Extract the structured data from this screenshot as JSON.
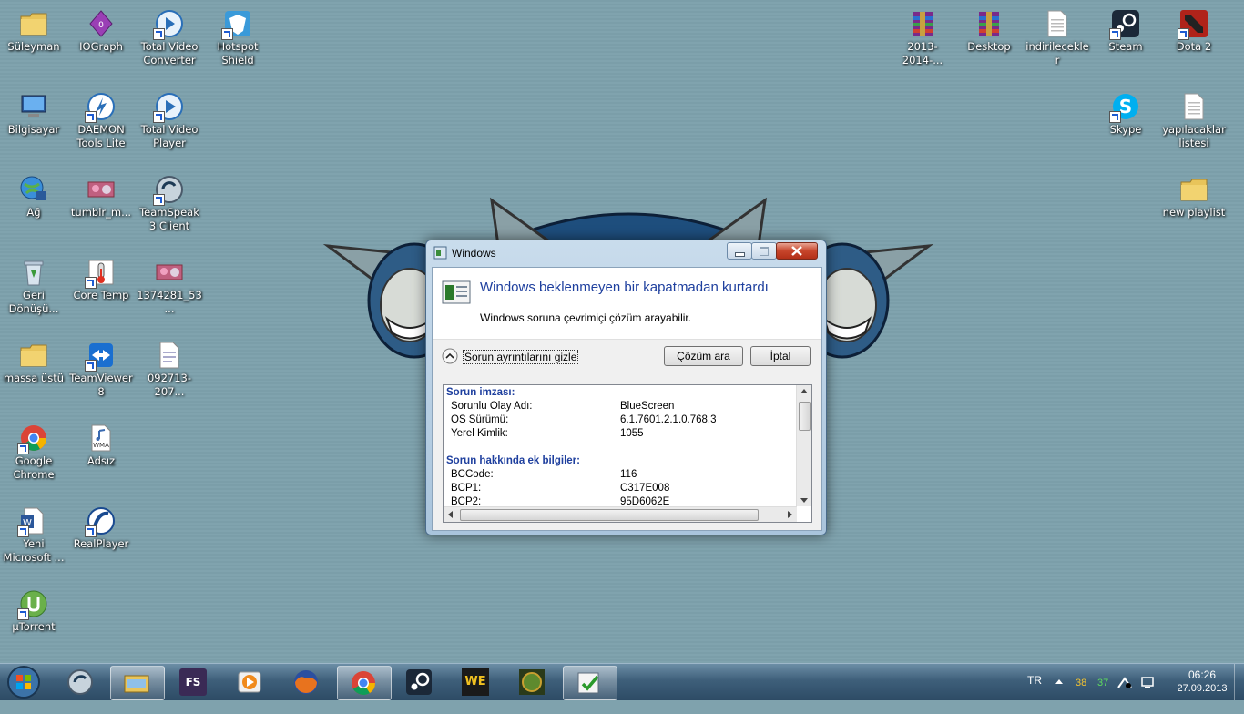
{
  "desktop": {
    "left_icons": [
      {
        "name": "suleyman",
        "label": "Süleyman",
        "icon": "folder-icon"
      },
      {
        "name": "iograph",
        "label": "IOGraph",
        "icon": "iograph-icon"
      },
      {
        "name": "total-video-converter",
        "label": "Total Video Converter",
        "icon": "converter-icon"
      },
      {
        "name": "hotspot-shield",
        "label": "Hotspot Shield",
        "icon": "shield-icon"
      },
      {
        "name": "bilgisayar",
        "label": "Bilgisayar",
        "icon": "computer-icon"
      },
      {
        "name": "daemon-tools",
        "label": "DAEMON Tools Lite",
        "icon": "daemon-icon"
      },
      {
        "name": "total-video-player",
        "label": "Total Video Player",
        "icon": "player-icon"
      },
      {
        "name": "ag",
        "label": "Ağ",
        "icon": "network-icon"
      },
      {
        "name": "tumblr",
        "label": "tumblr_m...",
        "icon": "image-icon"
      },
      {
        "name": "teamspeak",
        "label": "TeamSpeak 3 Client",
        "icon": "teamspeak-icon"
      },
      {
        "name": "recycle-bin",
        "label": "Geri Dönüşü...",
        "icon": "recycle-bin-icon"
      },
      {
        "name": "core-temp",
        "label": "Core Temp",
        "icon": "thermometer-icon"
      },
      {
        "name": "img-1374281",
        "label": "1374281_53...",
        "icon": "image-icon"
      },
      {
        "name": "massa-ustu",
        "label": "massa üstü",
        "icon": "folder-icon"
      },
      {
        "name": "teamviewer",
        "label": "TeamViewer 8",
        "icon": "teamviewer-icon"
      },
      {
        "name": "doc-092713",
        "label": "092713-207...",
        "icon": "file-icon"
      },
      {
        "name": "google-chrome",
        "label": "Google Chrome",
        "icon": "chrome-icon"
      },
      {
        "name": "adsiz",
        "label": "Adsız",
        "icon": "wma-icon"
      },
      {
        "name": "yeni-microsoft",
        "label": "Yeni Microsoft ...",
        "icon": "word-icon"
      },
      {
        "name": "realplayer",
        "label": "RealPlayer",
        "icon": "realplayer-icon"
      },
      {
        "name": "utorrent",
        "label": "µTorrent",
        "icon": "utorrent-icon"
      }
    ],
    "right_icons": [
      {
        "name": "archive-2013",
        "label": "2013-2014-...",
        "icon": "rar-icon"
      },
      {
        "name": "desktop-rar",
        "label": "Desktop",
        "icon": "rar-icon"
      },
      {
        "name": "indirilecekler",
        "label": "indirilecekler",
        "icon": "text-file-icon"
      },
      {
        "name": "steam",
        "label": "Steam",
        "icon": "steam-icon"
      },
      {
        "name": "dota2",
        "label": "Dota 2",
        "icon": "dota-icon"
      },
      {
        "name": "skype",
        "label": "Skype",
        "icon": "skype-icon"
      },
      {
        "name": "yapilacaklar",
        "label": "yapılacaklar listesi",
        "icon": "text-file-icon"
      },
      {
        "name": "new-playlist",
        "label": "new playlist",
        "icon": "folder-icon"
      }
    ]
  },
  "dialog": {
    "title": "Windows",
    "heading": "Windows beklenmeyen bir kapatmadan kurtardı",
    "subtext": "Windows soruna çevrimiçi çözüm arayabilir.",
    "toggle_label": "Sorun ayrıntılarını gizle",
    "solve_button": "Çözüm ara",
    "cancel_button": "İptal",
    "details": {
      "sig_title": "Sorun imzası:",
      "sig_rows": [
        {
          "k": "Sorunlu Olay Adı:",
          "v": "BlueScreen"
        },
        {
          "k": "OS Sürümü:",
          "v": "6.1.7601.2.1.0.768.3"
        },
        {
          "k": "Yerel Kimlik:",
          "v": "1055"
        }
      ],
      "extra_title": "Sorun hakkında ek bilgiler:",
      "extra_rows": [
        {
          "k": "BCCode:",
          "v": "116"
        },
        {
          "k": "BCP1:",
          "v": "C317E008"
        },
        {
          "k": "BCP2:",
          "v": "95D6062E"
        }
      ]
    }
  },
  "taskbar": {
    "items": [
      "start-orb-icon",
      "teamspeak-icon",
      "explorer-icon",
      "fs-icon",
      "media-player-icon",
      "firefox-icon",
      "chrome-icon",
      "steam-icon",
      "we-icon",
      "warcraft-icon",
      "problem-reports-icon"
    ],
    "fs_label": "FS",
    "we_label": "WE",
    "lang": "TR",
    "temp1": "38",
    "temp2": "37",
    "time": "06:26",
    "date": "27.09.2013"
  }
}
